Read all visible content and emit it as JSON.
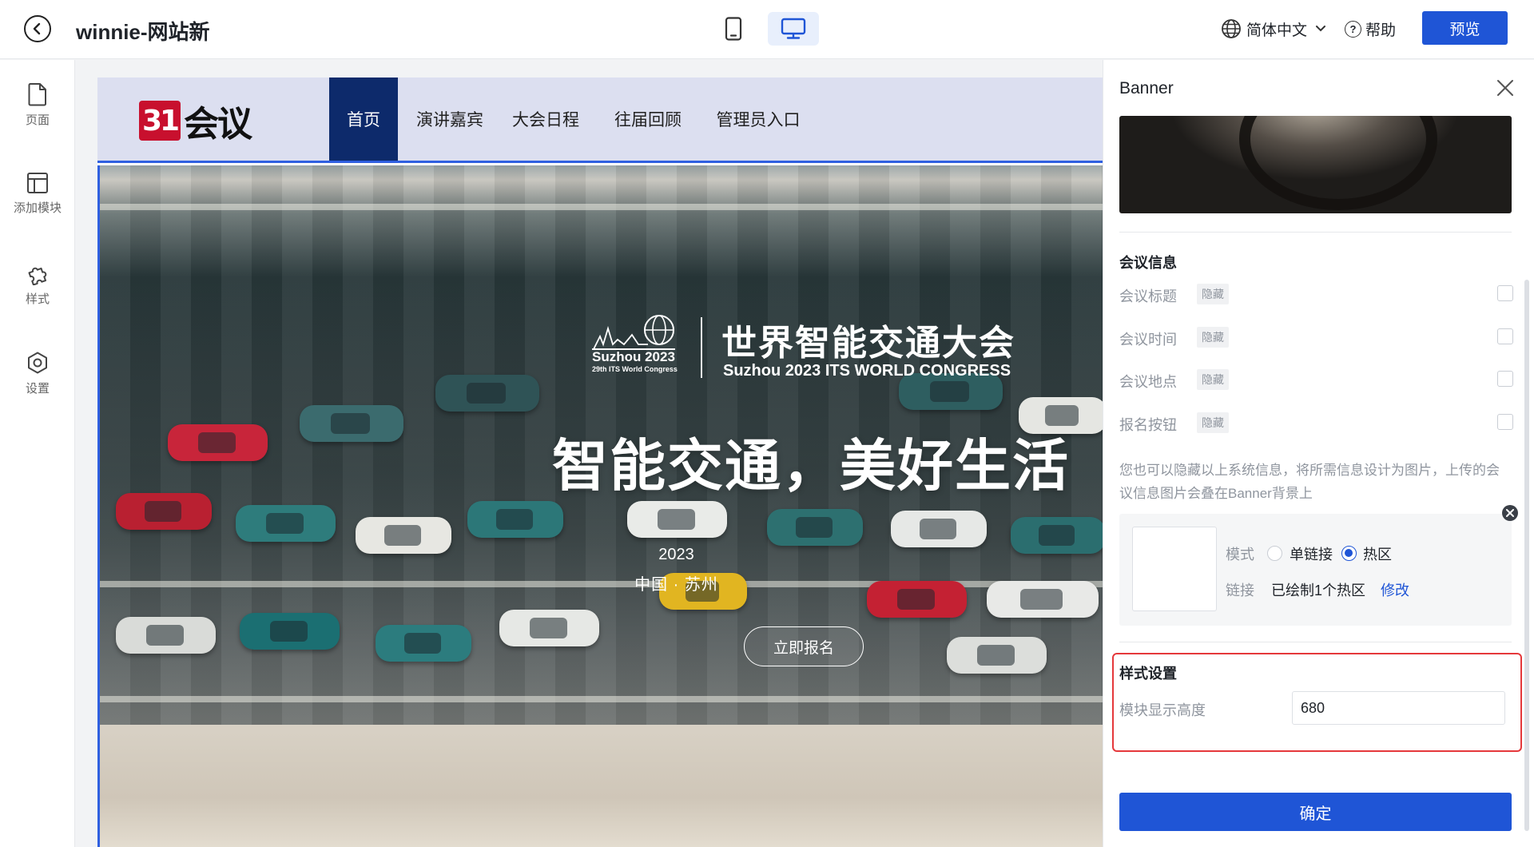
{
  "header": {
    "title": "winnie-网站新",
    "language": "简体中文",
    "help": "帮助",
    "preview": "预览"
  },
  "rail": {
    "items": [
      {
        "label": "页面",
        "icon": "page-icon"
      },
      {
        "label": "添加模块",
        "icon": "layout-icon"
      },
      {
        "label": "样式",
        "icon": "puzzle-icon"
      },
      {
        "label": "设置",
        "icon": "gear-icon"
      }
    ]
  },
  "site": {
    "logo_mark": "31",
    "logo_text": "会议",
    "nav": [
      "首页",
      "演讲嘉宾",
      "大会日程",
      "往届回顾",
      "管理员入口"
    ],
    "nav_active": "首页",
    "banner": {
      "logo_year": "Suzhou 2023",
      "logo_sub": "29th ITS World Congress",
      "cn_title": "世界智能交通大会",
      "en_title": "Suzhou 2023 ITS WORLD CONGRESS",
      "slogan": "智能交通，美好生活",
      "year": "2023",
      "place": "中国 · 苏州",
      "register": "立即报名"
    }
  },
  "panel": {
    "title": "Banner",
    "meeting_info_title": "会议信息",
    "fields": [
      {
        "label": "会议标题",
        "tag": "隐藏",
        "checked": false
      },
      {
        "label": "会议时间",
        "tag": "隐藏",
        "checked": false
      },
      {
        "label": "会议地点",
        "tag": "隐藏",
        "checked": false
      },
      {
        "label": "报名按钮",
        "tag": "隐藏",
        "checked": false
      }
    ],
    "hint": "您也可以隐藏以上系统信息，将所需信息设计为图片，上传的会议信息图片会叠在Banner背景上",
    "mode_label": "模式",
    "mode_options": [
      "单链接",
      "热区"
    ],
    "mode_selected": "热区",
    "link_label": "链接",
    "link_value": "已绘制1个热区",
    "link_edit": "修改",
    "style_title": "样式设置",
    "height_label": "模块显示高度",
    "height_value": "680",
    "confirm": "确定"
  },
  "colors": {
    "primary": "#1f55d6",
    "nav_active_bg": "#0d2a6b",
    "highlight_box": "#e5383b",
    "logo_red": "#c8102e"
  }
}
